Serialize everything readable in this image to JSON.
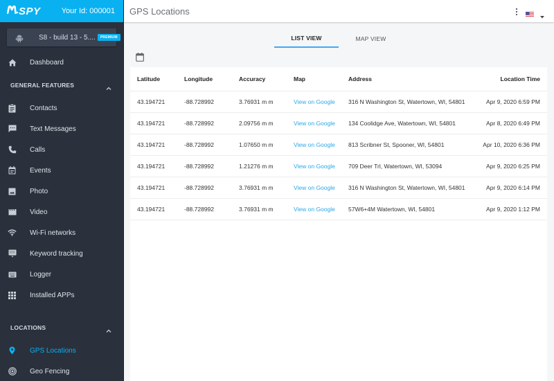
{
  "brand": {
    "logo": "SPY",
    "user_id": "Your Id: 000001",
    "accent": "#0ab1f0"
  },
  "device": {
    "icon": "android-icon",
    "name": "S8 - build 13 - 5....",
    "badge": "PREMIUM"
  },
  "sidebar": {
    "dashboard": {
      "label": "Dashboard",
      "icon": "home-icon"
    },
    "general_section": "GENERAL FEATURES",
    "general_items": [
      {
        "label": "Contacts",
        "icon": "contacts-clipboard-icon"
      },
      {
        "label": "Text Messages",
        "icon": "message-icon"
      },
      {
        "label": "Calls",
        "icon": "phone-icon"
      },
      {
        "label": "Events",
        "icon": "calendar-icon"
      },
      {
        "label": "Photo",
        "icon": "photo-icon"
      },
      {
        "label": "Video",
        "icon": "video-clapper-icon"
      },
      {
        "label": "Wi-Fi networks",
        "icon": "wifi-icon"
      },
      {
        "label": "Keyword tracking",
        "icon": "keyword-icon"
      },
      {
        "label": "Logger",
        "icon": "keyboard-icon"
      },
      {
        "label": "Installed APPs",
        "icon": "apps-grid-icon"
      }
    ],
    "locations_section": "LOCATIONS",
    "location_items": [
      {
        "label": "GPS Locations",
        "icon": "map-pin-icon",
        "active": true
      },
      {
        "label": "Geo Fencing",
        "icon": "target-icon",
        "active": false
      }
    ]
  },
  "header": {
    "title": "GPS Locations",
    "menu_icon": "more-vertical-icon",
    "language_icon": "us-flag-icon"
  },
  "tabs": [
    {
      "label": "LIST VIEW",
      "active": true
    },
    {
      "label": "MAP VIEW",
      "active": false
    }
  ],
  "table": {
    "columns": [
      "Latitude",
      "Longitude",
      "Accuracy",
      "Map",
      "Address",
      "Location Time"
    ],
    "rows": [
      {
        "lat": "43.194721",
        "lon": "-88.728992",
        "acc": "3.76931 m m",
        "map": "View on Google",
        "addr": "316 N Washington St, Watertown, WI, 54801",
        "time": "Apr 9, 2020 6:59 PM"
      },
      {
        "lat": "43.194721",
        "lon": "-88.728992",
        "acc": "2.09756 m m",
        "map": "View on Google",
        "addr": "134 Coolidge Ave, Watertown, WI, 54801",
        "time": "Apr 8, 2020 6:49 PM"
      },
      {
        "lat": "43.194721",
        "lon": "-88.728992",
        "acc": "1.07650 m m",
        "map": "View on Google",
        "addr": "813 Scribner St, Spooner, WI, 54801",
        "time": "Apr 10, 2020 6:36 PM"
      },
      {
        "lat": "43.194721",
        "lon": "-88.728992",
        "acc": "1.21276 m m",
        "map": "View on Google",
        "addr": "709 Deer Trl, Watertown, WI, 53094",
        "time": "Apr 9, 2020 6:25 PM"
      },
      {
        "lat": "43.194721",
        "lon": "-88.728992",
        "acc": "3.76931 m m",
        "map": "View on Google",
        "addr": "316 N Washington St, Watertown, WI, 54801",
        "time": "Apr 9, 2020 6:14 PM"
      },
      {
        "lat": "43.194721",
        "lon": "-88.728992",
        "acc": "3.76931 m m",
        "map": "View on Google",
        "addr": "57W6+4M Watertown, WI, 54801",
        "time": "Apr 9, 2020 1:12 PM"
      }
    ]
  }
}
